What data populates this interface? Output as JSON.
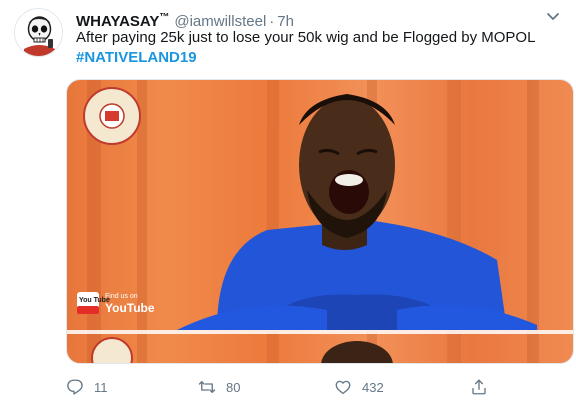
{
  "tweet": {
    "display_name": "WHAYASAY",
    "name_badge": "™",
    "handle": "@iamwillsteel",
    "separator": "·",
    "time": "7h",
    "text": "After paying 25k just to lose your 50k wig and be Flogged by MOPOL",
    "hashtag": "#NATIVELAND19"
  },
  "media": {
    "watermark_text_line1": "Find us on",
    "watermark_text_line2": "YouTube",
    "youtube_badge": "You Tube"
  },
  "actions": {
    "reply_count": "11",
    "retweet_count": "80",
    "like_count": "432"
  },
  "colors": {
    "link": "#1b95e0",
    "secondary_text": "#657786",
    "primary_text": "#14171a"
  }
}
